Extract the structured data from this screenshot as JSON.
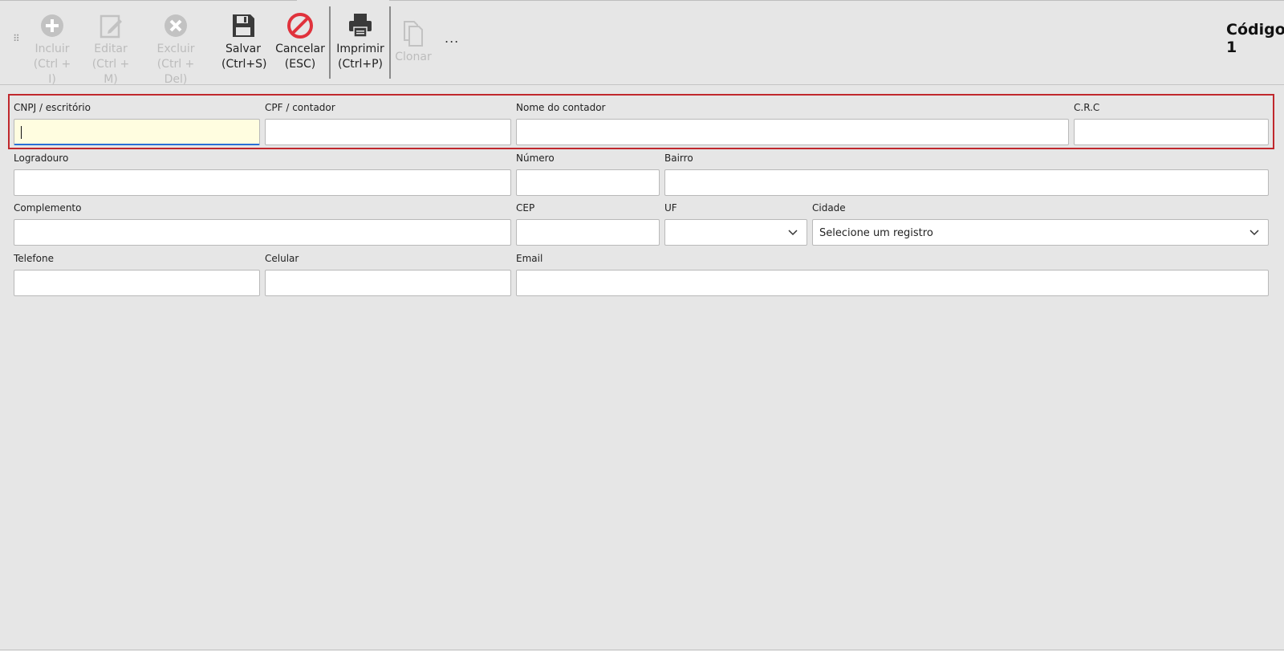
{
  "toolbar": {
    "buttons": [
      {
        "label": "Incluir",
        "shortcut": "(Ctrl + I)",
        "icon": "plus-circle-icon",
        "enabled": false
      },
      {
        "label": "Editar",
        "shortcut": "(Ctrl + M)",
        "icon": "edit-icon",
        "enabled": false
      },
      {
        "label": "Excluir",
        "shortcut": "(Ctrl + Del)",
        "icon": "x-circle-icon",
        "enabled": false
      },
      {
        "label": "Salvar",
        "shortcut": "(Ctrl+S)",
        "icon": "floppy-disk-icon",
        "enabled": true
      },
      {
        "label": "Cancelar",
        "shortcut": "(ESC)",
        "icon": "no-entry-icon",
        "enabled": true
      },
      {
        "label": "Imprimir",
        "shortcut": "(Ctrl+P)",
        "icon": "printer-icon",
        "enabled": true
      },
      {
        "label": "Clonar",
        "shortcut": "",
        "icon": "copy-icon",
        "enabled": false
      }
    ],
    "more_label": "...",
    "codigo_label": "Código",
    "codigo_value": "1"
  },
  "form": {
    "cnpj": {
      "label": "CNPJ / escritório",
      "value": ""
    },
    "cpf": {
      "label": "CPF / contador",
      "value": ""
    },
    "nome": {
      "label": "Nome do contador",
      "value": ""
    },
    "crc": {
      "label": "C.R.C",
      "value": ""
    },
    "logradouro": {
      "label": "Logradouro",
      "value": ""
    },
    "numero": {
      "label": "Número",
      "value": ""
    },
    "bairro": {
      "label": "Bairro",
      "value": ""
    },
    "complemento": {
      "label": "Complemento",
      "value": ""
    },
    "cep": {
      "label": "CEP",
      "value": ""
    },
    "uf": {
      "label": "UF",
      "value": ""
    },
    "cidade": {
      "label": "Cidade",
      "value": "Selecione um registro"
    },
    "telefone": {
      "label": "Telefone",
      "value": ""
    },
    "celular": {
      "label": "Celular",
      "value": ""
    },
    "email": {
      "label": "Email",
      "value": ""
    }
  },
  "colors": {
    "highlight_border": "#c0282d",
    "cancel_red": "#e0323c",
    "focus_bg": "#fffde0",
    "focus_underline": "#2a6fd6"
  }
}
